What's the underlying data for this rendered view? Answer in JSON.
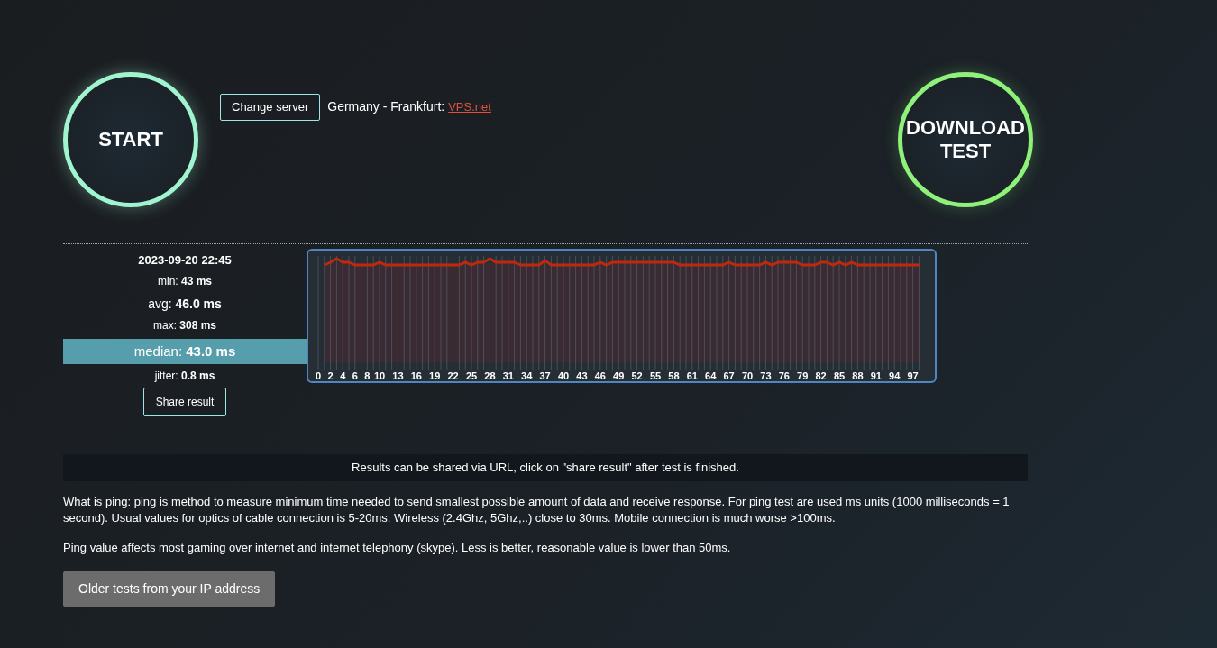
{
  "start_button": {
    "label": "START"
  },
  "server": {
    "button": "Change server",
    "location": "Germany - Frankfurt:",
    "provider": "VPS.net"
  },
  "download_button": {
    "label": "DOWNLOAD TEST"
  },
  "result": {
    "date": "2023-09-20 22:45",
    "stats": [
      {
        "label": "min:",
        "value": "43 ms",
        "kind": "small"
      },
      {
        "label": "avg:",
        "value": "46.0 ms",
        "kind": "medium"
      },
      {
        "label": "max:",
        "value": "308 ms",
        "kind": "small"
      },
      {
        "label": "median:",
        "value": "43.0 ms",
        "kind": "highlight"
      },
      {
        "label": "jitter:",
        "value": "0.8 ms",
        "kind": "small"
      }
    ],
    "share_button": "Share result"
  },
  "ping_chart": {
    "x_labels": [
      "0",
      "2",
      "4",
      "6",
      "8",
      "10",
      "13",
      "16",
      "19",
      "22",
      "25",
      "28",
      "31",
      "34",
      "37",
      "40",
      "43",
      "46",
      "49",
      "52",
      "55",
      "58",
      "61",
      "64",
      "67",
      "70",
      "73",
      "76",
      "79",
      "82",
      "85",
      "88",
      "91",
      "94",
      "97"
    ]
  },
  "share_note": "Results can be shared via URL, click on \"share result\" after test is finished.",
  "paragraphs": [
    "What is ping: ping is method to measure minimum time needed to send smallest possible amount of data and receive response. For ping test are used ms units (1000 milliseconds = 1 second). Usual values for optics of cable connection is 5-20ms. Wireless (2.4Ghz, 5Ghz,..) close to 30ms. Mobile connection is much worse >100ms.",
    "Ping value affects most gaming over internet and internet telephony (skype). Less is better, reasonable value is lower than 50ms."
  ],
  "older_tests_button": "Older tests from your IP address"
}
